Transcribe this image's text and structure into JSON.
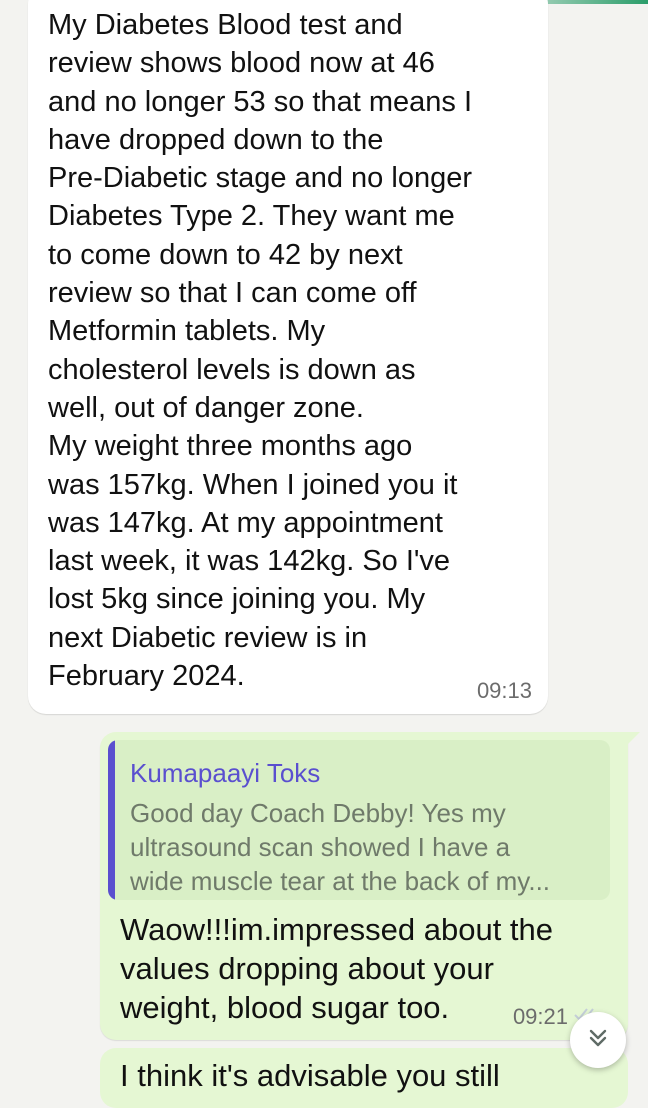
{
  "incoming_message": {
    "text": "My Diabetes Blood test and\nreview shows blood now at 46\nand no longer 53 so that means I\nhave dropped down to the\nPre-Diabetic stage and no longer\nDiabetes Type 2. They want me\nto come down to 42 by next\nreview so that I can come off\nMetformin tablets. My\ncholesterol levels is down as\nwell, out of danger zone.\nMy weight three months ago\nwas 157kg. When I joined you it\nwas 147kg. At my appointment\nlast week, it was 142kg. So I've\nlost 5kg since joining you. My\nnext Diabetic review is in\nFebruary 2024.",
    "time": "09:13"
  },
  "outgoing_message": {
    "quote": {
      "author": "Kumapaayi Toks",
      "text": "Good day Coach Debby! Yes my\nultrasound scan showed I have a\nwide muscle tear at the back of my..."
    },
    "text": "Waow!!!im.impressed about the\nvalues dropping about your\nweight, blood sugar too.",
    "time": "09:21",
    "status_icon": "double-check-icon"
  },
  "next_message": {
    "text": "I think it's advisable you still"
  },
  "scroll_button": {
    "icon": "double-chevron-down-icon"
  },
  "colors": {
    "background": "#f3f3f0",
    "incoming_bubble": "#ffffff",
    "outgoing_bubble": "#e5f7d3",
    "quote_accent": "#5a4fcf"
  }
}
